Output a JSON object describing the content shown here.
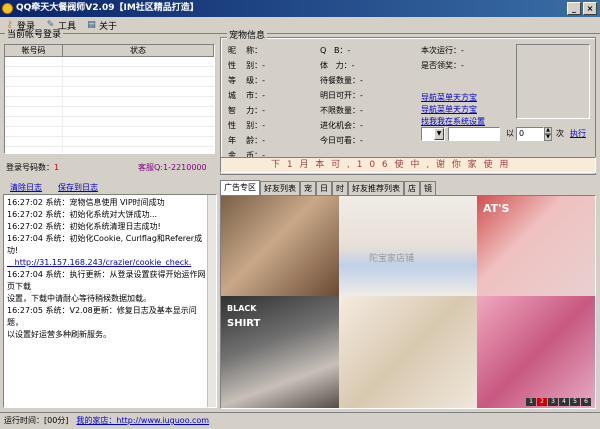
{
  "window": {
    "title": "QQ牵天大餐阀师V2.09【IM社区精品打造】"
  },
  "toolbar": {
    "items": [
      {
        "label": "登录",
        "icon": "key-icon"
      },
      {
        "label": "工具",
        "icon": "pencil-icon"
      },
      {
        "label": "关于",
        "icon": "book-icon"
      }
    ]
  },
  "account_panel": {
    "title": "当前帐号登录",
    "columns": [
      "帐号码",
      "状态"
    ],
    "online_label": "登录号码数：",
    "online_value": "1",
    "service_label": "客服Q:",
    "service_value": "1-2210000"
  },
  "pet_panel": {
    "title": "宠物信息",
    "fields_col1": [
      {
        "label": "昵",
        "sep": "称：",
        "value": ""
      },
      {
        "label": "性",
        "sep": "别：",
        "value": "-"
      },
      {
        "label": "等",
        "sep": "级：",
        "value": "-"
      },
      {
        "label": "城",
        "sep": "市：",
        "value": "-"
      },
      {
        "label": "智",
        "sep": "力：",
        "value": "-"
      },
      {
        "label": "性",
        "sep": "别：",
        "value": "-"
      },
      {
        "label": "年",
        "sep": "龄：",
        "value": "-"
      },
      {
        "label": "金",
        "sep": "币：",
        "value": "-"
      }
    ],
    "fields_col2": [
      {
        "label": "Q",
        "sep": "B：",
        "value": "-"
      },
      {
        "label": "体",
        "sep": "力：",
        "value": "-"
      },
      {
        "label": "待",
        "sep": "餐数量：",
        "value": "-"
      },
      {
        "label": "明",
        "sep": "日可开：",
        "value": "-"
      },
      {
        "label": "不",
        "sep": "限数量：",
        "value": "-"
      },
      {
        "label": "进",
        "sep": "化机会：",
        "value": "-"
      },
      {
        "label": "今",
        "sep": "日可看：",
        "value": "-"
      }
    ],
    "status_lines": [
      "本次运行：-",
      "是否领奖：-"
    ],
    "links": [
      "导航菜单天方宝",
      "导航菜单天方宝",
      "找我我在系统设置"
    ],
    "spin_label": "次",
    "spin_value": "0",
    "spin_prefix": "以",
    "execute_link": "执行",
    "marquee": "下 1 月 本 可 , 1 0 6 使 中 , 谢 你 家 使 用"
  },
  "log_panel": {
    "clear_link": "清除日志",
    "save_link": "保存到日志",
    "lines": [
      "16:27:02 系统：宠物信息使用 VIP时间成功",
      "16:27:02 系统：初始化系统对大饼成功...",
      "16:27:02 系统：初始化系统清理日志成功!",
      "16:27:04 系统：初始化Cookie, Curlflag和Referer成功!",
      "   http://31.157.168.243/crazier/cookie_check.",
      "16:27:04 系统：执行更新：从登录设置获得开始运作网页下载",
      "设置，下载中请耐心等待稍候数据加载。",
      "16:27:05 系统：V2.08更新：修复日志及基本显示问题，",
      "以设置好运营多种刷新服务。"
    ]
  },
  "tabs": [
    "广告专区",
    "好友列表",
    "宠",
    "日",
    "时",
    "好友推荐列表",
    "店",
    "镜"
  ],
  "active_tab": 0,
  "photo_overlay": [
    {
      "text": "陀宝家店铺"
    },
    {
      "text": "AT'S"
    },
    {
      "text": "BLACK"
    },
    {
      "text": "SHIRT"
    }
  ],
  "statusbar": {
    "left": "运行时间：[00分]",
    "link": "我的家店：http://www.iuguoo.com",
    "nav_dots": [
      "1",
      "2",
      "3",
      "4",
      "5",
      "6"
    ]
  },
  "colors": {
    "title_bar": "#0a246a",
    "link": "#0000cc",
    "purple": "#800080"
  }
}
